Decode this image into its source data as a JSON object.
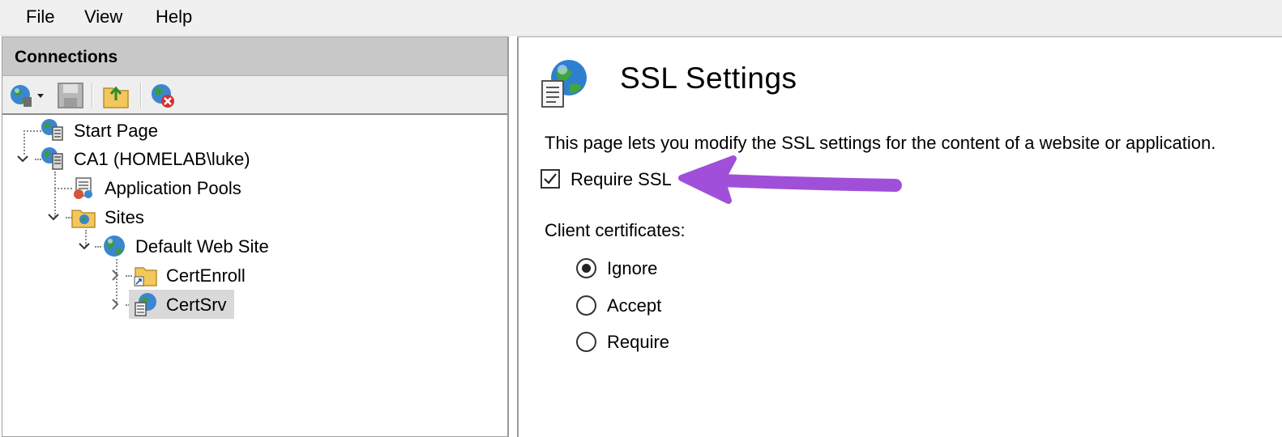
{
  "menu": {
    "file": "File",
    "view": "View",
    "help": "Help"
  },
  "connections": {
    "title": "Connections",
    "tree": {
      "start_page": "Start Page",
      "server": "CA1 (HOMELAB\\luke)",
      "app_pools": "Application Pools",
      "sites": "Sites",
      "default_site": "Default Web Site",
      "cert_enroll": "CertEnroll",
      "cert_srv": "CertSrv"
    }
  },
  "main": {
    "title": "SSL Settings",
    "description": "This page lets you modify the SSL settings for the content of a website or application.",
    "require_ssl": {
      "label": "Require SSL",
      "checked": true
    },
    "client_certificates": {
      "label": "Client certificates:",
      "options": [
        "Ignore",
        "Accept",
        "Require"
      ],
      "selected": "Ignore"
    }
  },
  "colors": {
    "annotation_arrow": "#a050d8",
    "selection": "#d9d9d9",
    "header": "#c8c8c8"
  }
}
